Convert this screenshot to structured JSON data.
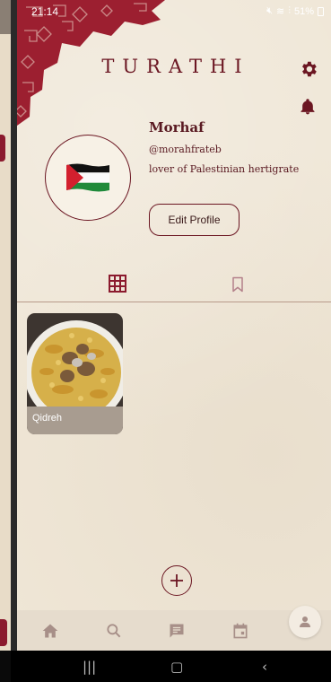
{
  "status_bar": {
    "time": "21:14",
    "indicators": "51%"
  },
  "header": {
    "app_title": "TURATHI",
    "settings_icon": "gear-icon",
    "notifications_icon": "bell-icon"
  },
  "profile": {
    "name": "Morhaf",
    "handle": "@morahfrateb",
    "bio": "lover of Palestinian hertigrate",
    "avatar_icon": "palestine-flag-icon",
    "edit_button_label": "Edit Profile"
  },
  "tabs": [
    {
      "name": "posts",
      "icon": "grid-icon",
      "active": true
    },
    {
      "name": "saved",
      "icon": "bookmark-icon",
      "active": false
    }
  ],
  "posts": [
    {
      "caption": "Qidreh",
      "image": "qidreh-rice-dish-photo"
    }
  ],
  "bottom_nav": [
    {
      "name": "home",
      "icon": "home-icon"
    },
    {
      "name": "search",
      "icon": "search-icon"
    },
    {
      "name": "chat",
      "icon": "chat-icon"
    },
    {
      "name": "calendar",
      "icon": "calendar-icon"
    },
    {
      "name": "profile",
      "icon": "person-icon",
      "active": true
    }
  ],
  "colors": {
    "accent": "#6b1622",
    "background": "#efe6d6",
    "nav_background": "#e6dccd"
  }
}
